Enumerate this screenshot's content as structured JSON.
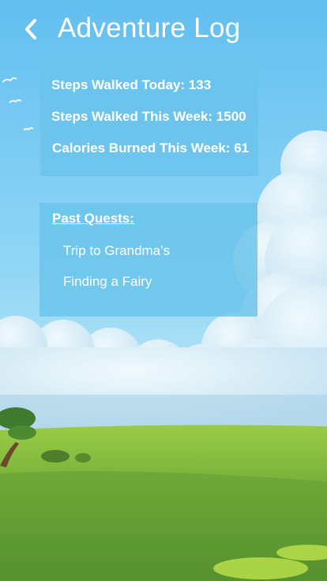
{
  "header": {
    "title": "Adventure Log",
    "back_icon": "chevron-left-icon"
  },
  "stats": {
    "steps_today": "Steps Walked Today: 133",
    "steps_week": "Steps Walked This Week: 1500",
    "calories_week": "Calories Burned This Week: 61"
  },
  "quests": {
    "heading": "Past Quests:",
    "items": [
      "Trip to Grandma’s",
      "Finding a Fairy"
    ]
  },
  "colors": {
    "panel": "#6AC3EB",
    "sky": "#7FCDF4",
    "grass": "#7BB83C",
    "text": "#FFFFFF"
  }
}
